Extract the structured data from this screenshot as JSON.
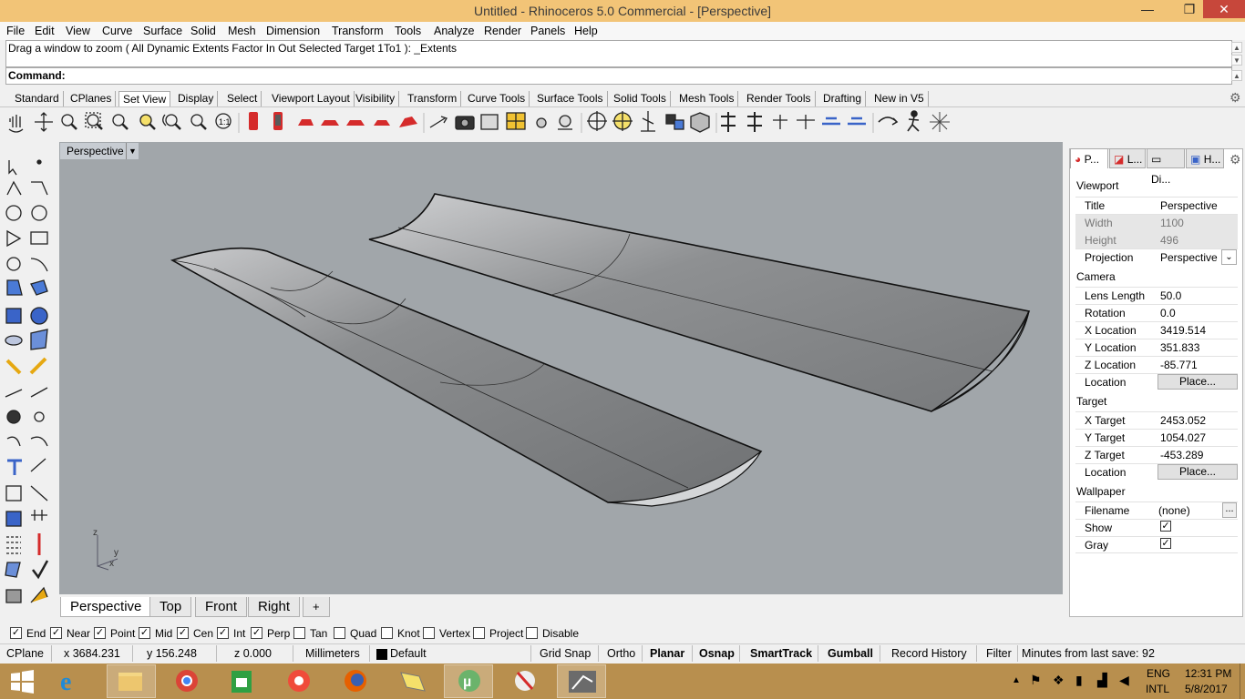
{
  "window": {
    "title": "Untitled - Rhinoceros 5.0 Commercial - [Perspective]",
    "min_glyph": "—",
    "restore_glyph": "❐",
    "close_glyph": "✕"
  },
  "menu": [
    "File",
    "Edit",
    "View",
    "Curve",
    "Surface",
    "Solid",
    "Mesh",
    "Dimension",
    "Transform",
    "Tools",
    "Analyze",
    "Render",
    "Panels",
    "Help"
  ],
  "command": {
    "history": "Drag a window to zoom ( All  Dynamic  Extents  Factor  In  Out  Selected  Target  1To1 ): _Extents",
    "label": "Command:",
    "value": ""
  },
  "toolbar_tabs": [
    "Standard",
    "CPlanes",
    "Set View",
    "Display",
    "Select",
    "Viewport Layout",
    "Visibility",
    "Transform",
    "Curve Tools",
    "Surface Tools",
    "Solid Tools",
    "Mesh Tools",
    "Render Tools",
    "Drafting",
    "New in V5"
  ],
  "active_toolbar_tab": "Set View",
  "viewport": {
    "name": "Perspective",
    "arrow": "▼",
    "axes": {
      "z": "z",
      "y": "y",
      "x": "x"
    }
  },
  "viewport_tabs": [
    "Perspective",
    "Top",
    "Front",
    "Right"
  ],
  "viewport_add": "+",
  "panel": {
    "tabs": [
      "P...",
      "L...",
      "Di...",
      "H..."
    ],
    "gear": "⚙",
    "sections": {
      "viewport": "Viewport",
      "camera": "Camera",
      "target": "Target",
      "wallpaper": "Wallpaper"
    },
    "viewport_rows": [
      {
        "label": "Title",
        "value": "Perspective"
      },
      {
        "label": "Width",
        "value": "1100"
      },
      {
        "label": "Height",
        "value": "496"
      },
      {
        "label": "Projection",
        "value": "Perspective"
      }
    ],
    "camera_rows": [
      {
        "label": "Lens Length",
        "value": "50.0"
      },
      {
        "label": "Rotation",
        "value": "0.0"
      },
      {
        "label": "X Location",
        "value": "3419.514"
      },
      {
        "label": "Y Location",
        "value": "351.833"
      },
      {
        "label": "Z Location",
        "value": "-85.771"
      },
      {
        "label": "Location",
        "value": "Place..."
      }
    ],
    "target_rows": [
      {
        "label": "X Target",
        "value": "2453.052"
      },
      {
        "label": "Y Target",
        "value": "1054.027"
      },
      {
        "label": "Z Target",
        "value": "-453.289"
      },
      {
        "label": "Location",
        "value": "Place..."
      }
    ],
    "wallpaper_rows": [
      {
        "label": "Filename",
        "value": "(none)",
        "button": "..."
      },
      {
        "label": "Show",
        "checked": true
      },
      {
        "label": "Gray",
        "checked": true
      }
    ]
  },
  "osnaps": [
    {
      "label": "End",
      "checked": true
    },
    {
      "label": "Near",
      "checked": true
    },
    {
      "label": "Point",
      "checked": true
    },
    {
      "label": "Mid",
      "checked": true
    },
    {
      "label": "Cen",
      "checked": true
    },
    {
      "label": "Int",
      "checked": true
    },
    {
      "label": "Perp",
      "checked": true
    },
    {
      "label": "Tan",
      "checked": false
    },
    {
      "label": "Quad",
      "checked": false
    },
    {
      "label": "Knot",
      "checked": false
    },
    {
      "label": "Vertex",
      "checked": false
    },
    {
      "label": "Project",
      "checked": false
    },
    {
      "label": "Disable",
      "checked": false
    }
  ],
  "status": {
    "cplane": "CPlane",
    "x": "x 3684.231",
    "y": "y 156.248",
    "z": "z 0.000",
    "units": "Millimeters",
    "layer": "Default",
    "grid_snap": "Grid Snap",
    "ortho": "Ortho",
    "planar": "Planar",
    "osnap": "Osnap",
    "smarttrack": "SmartTrack",
    "gumball": "Gumball",
    "record_history": "Record History",
    "filter": "Filter",
    "minutes": "Minutes from last save: 92"
  },
  "taskbar": {
    "lang1": "ENG",
    "lang2": "INTL",
    "time": "12:31 PM",
    "date": "5/8/2017"
  },
  "colors": {
    "titlebar": "#f2c477",
    "viewport_bg": "#a1a6aa",
    "taskbar": "#b88f4e",
    "surface": "#8a8c8e"
  }
}
